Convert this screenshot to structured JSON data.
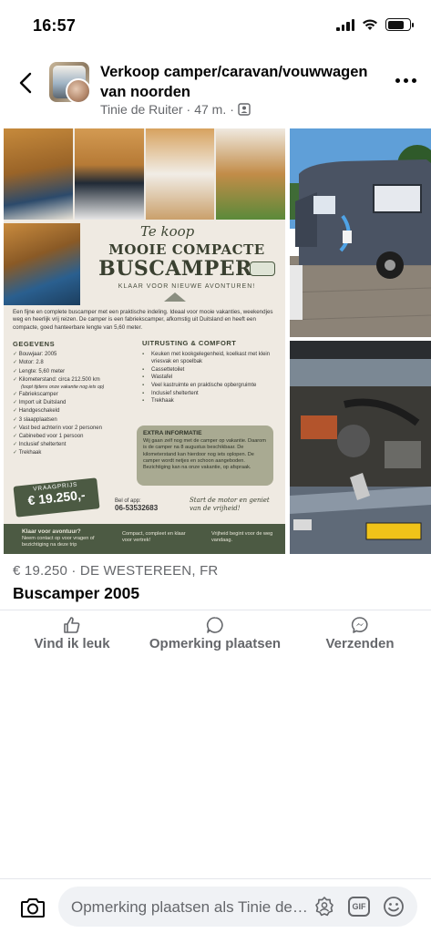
{
  "status_bar": {
    "time": "16:57"
  },
  "header": {
    "title": "Verkoop camper/caravan/vouwwagen van noorden",
    "author": "Tinie de Ruiter",
    "separator": "·",
    "time_ago": "47 m.",
    "privacy_icon": "group-members-icon"
  },
  "flyer": {
    "te_koop": "Te koop",
    "headline": "MOOIE COMPACTE",
    "title": "BUSCAMPER",
    "tagline": "KLAAR VOOR NIEUWE AVONTUREN!",
    "intro": "Een fijne en complete buscamper met een praktische indeling. Ideaal voor mooie vakanties, weekendjes weg en heerlijk vrij reizen. De camper is een fabriekscamper, afkomstig uit Duitsland en heeft een compacte, goed hanteerbare lengte van 5,60 meter.",
    "gegevens_heading": "GEGEVENS",
    "gegevens": [
      "Bouwjaar: 2005",
      "Motor: 2.8",
      "Lengte: 5,60 meter",
      "Kilometerstand: circa 212.500 km",
      "(loopt tijdens onze vakantie nog iets op)",
      "Fabriekscamper",
      "Import uit Duitsland",
      "Handgeschakeld",
      "3 slaapplaatsen",
      "Vast bed achterin voor 2 personen",
      "Cabinebed voor 1 persoon",
      "Inclusief sheltertent",
      "Trekhaak"
    ],
    "uitrusting_heading": "UITRUSTING & COMFORT",
    "uitrusting": [
      "Keuken met kookgelegenheid, koelkast met klein vriesvak en spoelbak",
      "Cassettetoilet",
      "Wastafel",
      "Veel kastruimte en praktische opbergruimte",
      "Inclusief sheltertent",
      "Trekhaak"
    ],
    "extra_heading": "EXTRA INFORMATIE",
    "extra_text": "Wij gaan zelf nog met de camper op vakantie. Daarom is de camper na 8 augustus beschikbaar. De kilometerstand kan hierdoor nog iets oplopen. De camper wordt netjes en schoon aangeboden. Bezichtiging kan na onze vakantie, op afspraak.",
    "price_label": "VRAAGPRIJS",
    "price_value": "€ 19.250,-",
    "phone_label": "Bel of app:",
    "phone_number": "06-53532683",
    "slogan": "Start de motor en geniet van de vrijheid!",
    "footer_a_title": "Klaar voor avontuur?",
    "footer_a_text": "Neem contact op voor vragen of bezichtiging na deze trip",
    "footer_b_text": "Compact, compleet en klaar voor vertrek!",
    "footer_c_text": "Vrijheid begint voor de weg vandaag."
  },
  "listing": {
    "price_location": "€ 19.250 · DE WESTEREEN, FR",
    "title": "Buscamper 2005"
  },
  "actions": {
    "like": "Vind ik leuk",
    "comment": "Opmerking plaatsen",
    "share": "Verzenden"
  },
  "comment_bar": {
    "placeholder": "Opmerking plaatsen als Tinie de Ruiter"
  },
  "colors": {
    "text_primary": "#050505",
    "text_secondary": "#65676b",
    "input_bg": "#f0f2f5",
    "flyer_green": "#4c5a43",
    "flyer_bg": "#efeae2"
  }
}
